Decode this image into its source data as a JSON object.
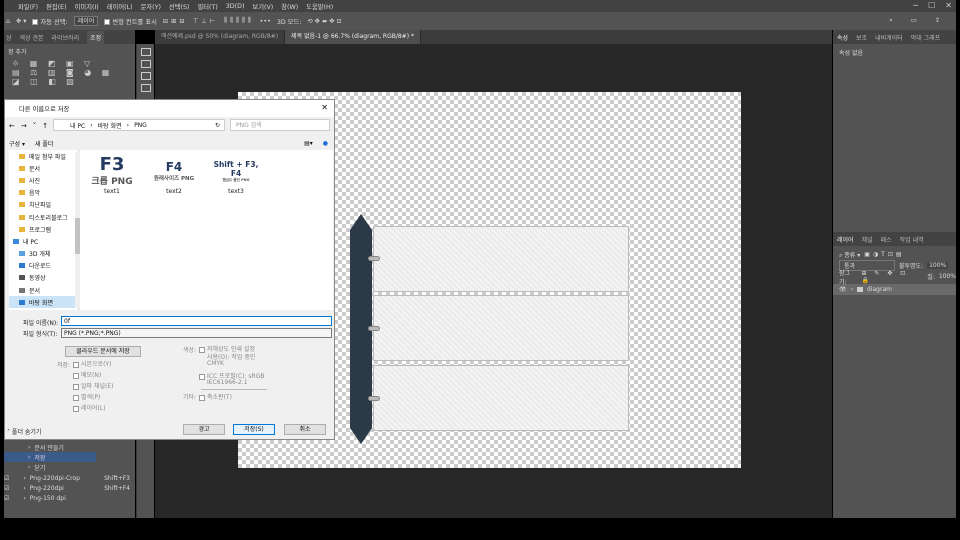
{
  "menubar": {
    "items": [
      "파일(F)",
      "편집(E)",
      "이미지(I)",
      "레이어(L)",
      "문자(Y)",
      "선택(S)",
      "필터(T)",
      "3D(D)",
      "보기(V)",
      "창(W)",
      "도움말(H)"
    ]
  },
  "options": {
    "auto_select": "자동 선택:",
    "layer": "레이어",
    "transform": "변형 컨트롤 표시",
    "threeD": "3D 모드:"
  },
  "left_panel": {
    "tabs": [
      "상",
      "색상 견본",
      "라이브러리",
      "조정"
    ],
    "add_label": "정 추가"
  },
  "doc_tabs": [
    "액션예제.psd @ 50% (diagram, RGB/8#)",
    "제목 없음-1 @ 66.7% (diagram, RGB/8#) *"
  ],
  "right_panel": {
    "tabs": [
      "속성",
      "보조",
      "내비게이터",
      "막대 그래프"
    ],
    "properties_empty": "속성 없음",
    "layer_tabs": [
      "레이어",
      "채널",
      "패스",
      "작업 내역"
    ],
    "kind": "종류",
    "blend": "통과",
    "opacity_label": "불투명도:",
    "opacity": "100%",
    "lock": "잠그기:",
    "fill_label": "칠:",
    "fill": "100%",
    "layer_name": "diagram"
  },
  "dialog": {
    "title": "다른 이름으로 저장",
    "path": [
      "내 PC",
      "바탕 화면",
      "PNG"
    ],
    "search_placeholder": "PNG 검색",
    "organize": "구성 ▾",
    "new_folder": "새 폴더",
    "tree": [
      "메일 첨부 파일",
      "문서",
      "사진",
      "음악",
      "치난파일",
      "티스토리블로그",
      "프로그램",
      "내 PC",
      "3D 개체",
      "다운로드",
      "동영상",
      "문서",
      "바탕 화면"
    ],
    "files": [
      {
        "big": "F3",
        "sub": "크롭 PNG",
        "name": "text1"
      },
      {
        "big": "F4",
        "sub": "원래사이즈 PNG",
        "name": "text2"
      },
      {
        "big": "Shift + F3, F4",
        "sub": "웹심도 줄인 PNG",
        "name": "text3"
      }
    ],
    "filename_label": "파일 이름(N):",
    "filename": "0f",
    "format_label": "파일 형식(T):",
    "format": "PNG (*.PNG;*.PNG)",
    "cloud_button": "클라우드 문서에 저장",
    "color_label": "색상:",
    "proof": "저해상도 인쇄 설정",
    "use_label": "사용(O): 작업 중인",
    "cmyk": "CMYK",
    "icc": "ICC 프로필(C): sRGB",
    "icc2": "IEC61966-2.1",
    "save_label": "저장:",
    "as_copy": "사본으로(Y)",
    "notes": "메모(N)",
    "alpha": "알파 채널(E)",
    "spot": "별색(P)",
    "layers": "레이어(L)",
    "other_label": "기타:",
    "thumbnail": "축소판(T)",
    "hide_folders": "폴더 숨기기",
    "ok": "경고",
    "save": "저장(S)",
    "cancel": "취소"
  },
  "actions": [
    {
      "label": "문서 만들기",
      "sc": ""
    },
    {
      "label": "저장",
      "sc": ""
    },
    {
      "label": "닫기",
      "sc": ""
    },
    {
      "label": "Png-220dpi-Crop",
      "sc": "Shift+F3"
    },
    {
      "label": "Png-220dpi",
      "sc": "Shift+F4"
    },
    {
      "label": "Png-150 dpi",
      "sc": ""
    }
  ]
}
